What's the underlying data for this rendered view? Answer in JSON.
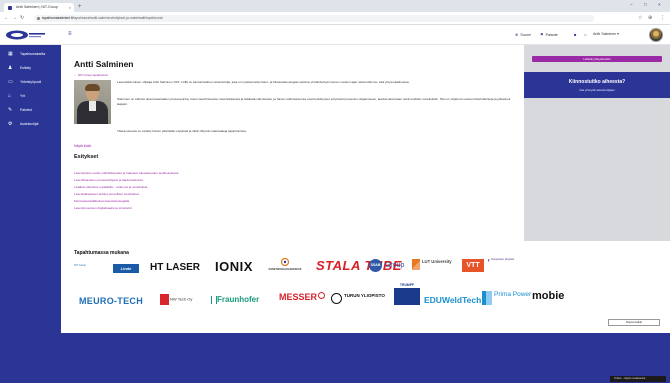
{
  "browser": {
    "tab_title": "Antti Salminen | NIT-Group",
    "url_domain": "tapahtumakalenteri.fi",
    "url_path": "/tapahtumat/antti-salminen/esitykset-ja-materiaalit/tapahtumat",
    "icons": [
      "back-icon",
      "forward-icon",
      "reload-icon",
      "star-icon",
      "extensions-icon",
      "menu-icon"
    ]
  },
  "header": {
    "nav": [
      {
        "icon": "globe-icon",
        "label": "Suomi"
      },
      {
        "icon": "flag-icon",
        "label": "Palaute"
      },
      {
        "icon": "bell-icon",
        "label": ""
      },
      {
        "icon": "home-icon",
        "label": ""
      }
    ],
    "user_name": "Antti Salminen"
  },
  "sidebar": {
    "items": [
      {
        "icon": "dashboard-icon",
        "label": "Tapahtumakartta"
      },
      {
        "icon": "users-icon",
        "label": "Esittely"
      },
      {
        "icon": "monitor-icon",
        "label": "Yhteistyöpuoli"
      },
      {
        "icon": "home-icon",
        "label": "Yrit"
      },
      {
        "icon": "edit-icon",
        "label": "Palvelut"
      },
      {
        "icon": "settings-icon",
        "label": "Asiantuntijat"
      }
    ]
  },
  "profile": {
    "name": "Antti Salminen",
    "breadcrumb": "← NIT-Group tapahtumat",
    "paragraphs": [
      "Lasertutkimuksen ohjaaja Antti Salminen (NIT, LAB) on kansainvälinen asiantuntija, joka on työskennellyt laser- ja hitsausteknologian parissa yli kahdenkymmenen vuoden ajan sekä tutkimus- että yritysmaailmassa.",
      "Salminen on tutkinut lasermateriaalien prosessointia, kuten laserhitsausta, laserleikkausta ja lisäävää valmistusta, ja hänen tutkimuksensa ovat keskittyneet erityisesti prosessin ohjaamiseen, laadunvalvontaan sekä teollisiin sovelluksiin. Hän on ohjannut useita tohtoritutkintoja ja julkaissut laajasti.",
      "Tässä osiossa on esitelty hänen pitämiään esityksiä ja niihin liittyviä materiaaleja tapahtumista."
    ],
    "more_link": "Näytä lisää",
    "section_title": "Esitykset",
    "presentations": [
      "Lasertyöstön uudet mahdollisuudet ja haasteet tulevaisuuden teollisuudessa",
      "Laserhitsauksen prosessiohjaus ja laadunvalvonta",
      "Lisäävä valmistus metalleilla – tutkimus ja sovellukset",
      "Laserleikkauksen kehitys ja teolliset sovellukset",
      "Monimateriaaliliitokset laserteknologialla",
      "Laserprosessien digitalisaatio ja simulointi"
    ]
  },
  "aside": {
    "button_label": "Lähetä yhteydenotto",
    "question": "Kiinnostuitko aiheesta?",
    "sub": "Ota yhteyttä asiantuntijaan"
  },
  "partners": {
    "title": "Tapahtumassa mukana",
    "logos": [
      {
        "name": "NIT Group",
        "color": "#2b6fb8"
      },
      {
        "name": "Linde",
        "color": "#1a5aa6"
      },
      {
        "name": "HT LASER",
        "color": "#111111"
      },
      {
        "name": "IONIX",
        "color": "#111111"
      },
      {
        "name": "KONETEKNOLOGIAKESKUS",
        "color": "#e07a1f"
      },
      {
        "name": "STALA TUBE",
        "color": "#d92027"
      },
      {
        "name": "SSAB",
        "color": "#2f5aa8"
      },
      {
        "name": "Group",
        "color": "#2f5aa8"
      },
      {
        "name": "LUT University",
        "color": "#444444"
      },
      {
        "name": "VTT",
        "color": "#e8542a"
      },
      {
        "name": "Tampereen yliopisto",
        "color": "#4e2a84"
      },
      {
        "name": "MEURO-TECH",
        "color": "#1c6fb8"
      },
      {
        "name": "NW Tech Oy",
        "color": "#d8262d"
      },
      {
        "name": "Fraunhofer",
        "color": "#179c7d"
      },
      {
        "name": "MESSER",
        "color": "#d6222a"
      },
      {
        "name": "TURUN YLIOPISTO",
        "color": "#111111"
      },
      {
        "name": "TRUMPF",
        "color": "#1a3b8c"
      },
      {
        "name": "EDUWeldTech",
        "color": "#1c8fd0"
      },
      {
        "name": "Prima Power",
        "color": "#1c8fd0"
      },
      {
        "name": "mobie",
        "color": "#111111"
      }
    ],
    "more_button": "Näytä kaikki"
  },
  "footer": {
    "status": "Online – käytä muokkausta"
  },
  "colors": {
    "brand": "#2b3596",
    "accent": "#9b2aa6",
    "aside_bg": "#d8d9dd"
  }
}
